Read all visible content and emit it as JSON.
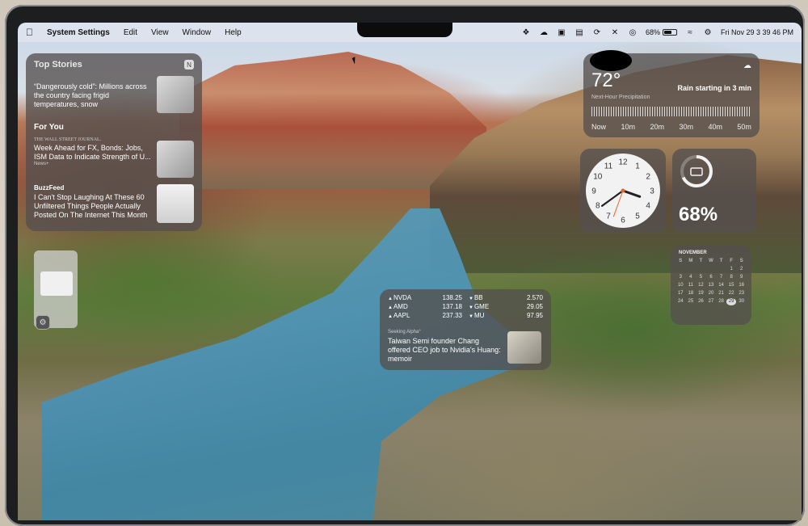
{
  "menubar": {
    "app_name": "System Settings",
    "menus": [
      "Edit",
      "View",
      "Window",
      "Help"
    ],
    "battery_percent": "68%",
    "battery_level": 0.68,
    "datetime": "Fri Nov 29  3 39 46 PM",
    "status_icons": [
      "dropbox-icon",
      "cloud-sync-icon",
      "box-icon",
      "document-icon",
      "sync-icon",
      "mute-icon",
      "airdrop-icon",
      "wifi-icon",
      "control-center-icon"
    ]
  },
  "news": {
    "title": "Top Stories",
    "top_story": {
      "source": "",
      "headline": "“Dangerously cold”: Millions across the country facing frigid temperatures, snow"
    },
    "for_you_title": "For You",
    "stories": [
      {
        "source": "THE WALL STREET JOURNAL.",
        "tag": "News+",
        "headline": "Week Ahead for FX, Bonds: Jobs, ISM Data to Indicate Strength of U..."
      },
      {
        "source": "BuzzFeed",
        "tag": "",
        "headline": "I Can't Stop Laughing At These 60 Unfiltered Things People Actually Posted On The Internet This Month"
      }
    ]
  },
  "weather": {
    "temperature": "72°",
    "forecast": "Rain starting in 3 min",
    "label": "Next-Hour Precipitation",
    "ticks": [
      "Now",
      "10m",
      "20m",
      "30m",
      "40m",
      "50m"
    ]
  },
  "clock": {
    "numbers": [
      "12",
      "1",
      "2",
      "3",
      "4",
      "5",
      "6",
      "7",
      "8",
      "9",
      "10",
      "11"
    ],
    "hour": 3,
    "minute": 39
  },
  "battery_widget": {
    "percent": "68%",
    "level": 0.68
  },
  "calendar": {
    "month": "NOVEMBER",
    "weekday_headers": [
      "S",
      "M",
      "T",
      "W",
      "T",
      "F",
      "S"
    ],
    "days": [
      "",
      "",
      "",
      "",
      "",
      "1",
      "2",
      "3",
      "4",
      "5",
      "6",
      "7",
      "8",
      "9",
      "10",
      "11",
      "12",
      "13",
      "14",
      "15",
      "16",
      "17",
      "18",
      "19",
      "20",
      "21",
      "22",
      "23",
      "24",
      "25",
      "26",
      "27",
      "28",
      "29",
      "30"
    ],
    "today": "29"
  },
  "stocks": {
    "left": [
      {
        "symbol": "NVDA",
        "arrow": "▲",
        "price": "138.25"
      },
      {
        "symbol": "AMD",
        "arrow": "▲",
        "price": "137.18"
      },
      {
        "symbol": "AAPL",
        "arrow": "▲",
        "price": "237.33"
      }
    ],
    "right": [
      {
        "symbol": "BB",
        "arrow": "▼",
        "price": "2.570"
      },
      {
        "symbol": "GME",
        "arrow": "▼",
        "price": "29.05"
      },
      {
        "symbol": "MU",
        "arrow": "▼",
        "price": "97.95"
      }
    ],
    "article_source": "Seeking Alpha°",
    "article_headline": "Taiwan Semi founder Chang offered CEO job to Nvidia's Huang: memoir"
  }
}
